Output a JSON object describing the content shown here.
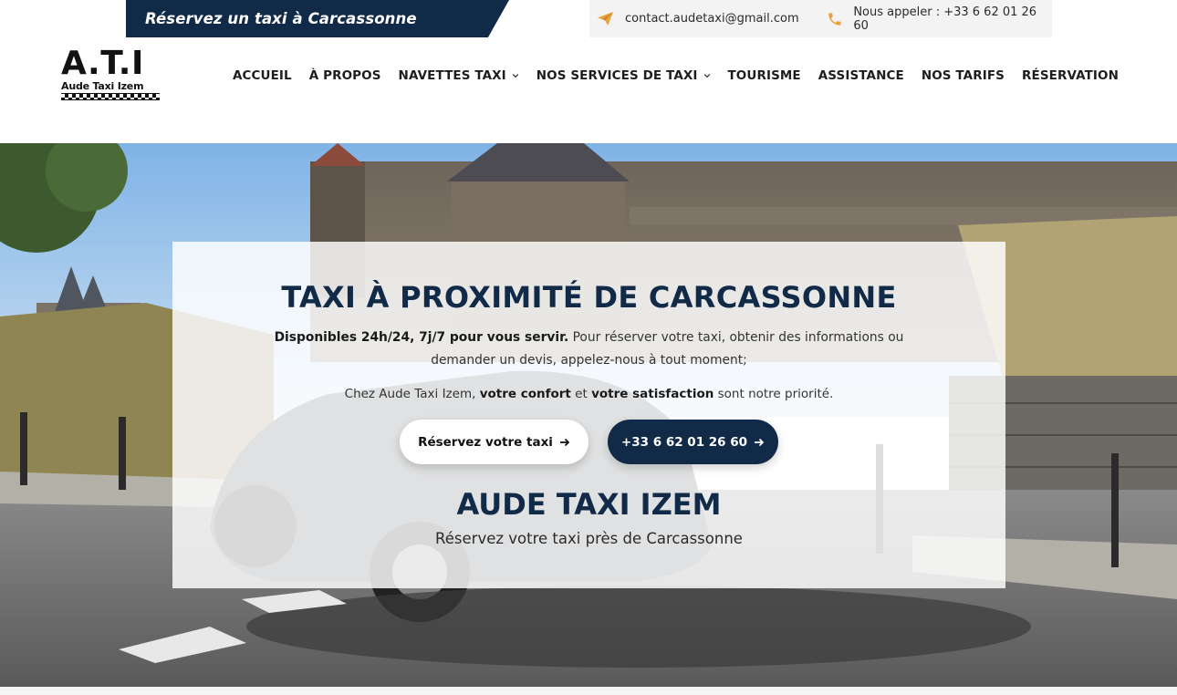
{
  "topbar": {
    "tagline": "Réservez un taxi à Carcassonne",
    "email": "contact.audetaxi@gmail.com",
    "phone_label": "Nous appeler : +33 6 62 01 26 60"
  },
  "logo": {
    "letters": "A.T.I",
    "subtitle": "Aude Taxi Izem"
  },
  "nav": {
    "items": [
      {
        "label": "ACCUEIL",
        "dropdown": false
      },
      {
        "label": "À PROPOS",
        "dropdown": false
      },
      {
        "label": "NAVETTES TAXI",
        "dropdown": true
      },
      {
        "label": "NOS SERVICES DE TAXI",
        "dropdown": true
      },
      {
        "label": "TOURISME",
        "dropdown": false
      },
      {
        "label": "ASSISTANCE",
        "dropdown": false
      },
      {
        "label": "NOS TARIFS",
        "dropdown": false
      },
      {
        "label": "RÉSERVATION",
        "dropdown": false
      }
    ]
  },
  "hero": {
    "title": "TAXI À PROXIMITÉ DE CARCASSONNE",
    "line1_bold": "Disponibles 24h/24, 7j/7 pour vous servir.",
    "line1_rest": " Pour réserver votre taxi, obtenir des informations ou",
    "line2": "demander un devis, appelez-nous à tout moment;",
    "line3_part1": "Chez Aude Taxi Izem, ",
    "line3_bold1": "votre confort",
    "line3_part2": " et ",
    "line3_bold2": "votre satisfaction",
    "line3_part3": " sont notre priorité.",
    "book_button": "Réservez votre taxi",
    "call_button": "+33 6 62 01 26 60",
    "brand": "AUDE TAXI IZEM",
    "brand_sub": "Réservez votre taxi près de Carcassonne"
  },
  "colors": {
    "navy": "#112a48",
    "accent_orange": "#e8a33d"
  },
  "icons": {
    "email": "paper-plane-icon",
    "phone": "phone-icon",
    "dropdown": "chevron-down-icon",
    "button_arrow": "arrow-right-icon"
  }
}
